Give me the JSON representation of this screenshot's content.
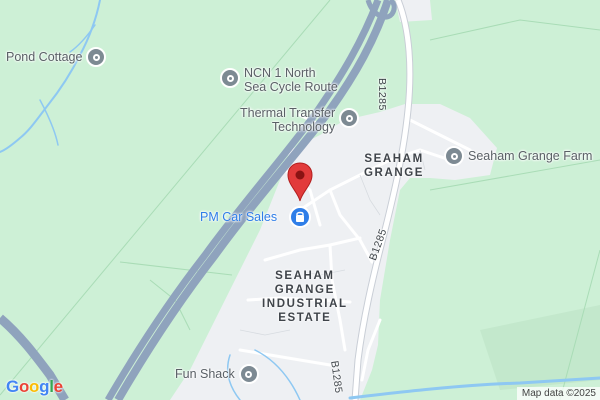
{
  "map": {
    "poi": {
      "pond_cottage": "Pond Cottage",
      "ncn_route": "NCN 1 North\nSea Cycle Route",
      "thermal_transfer": "Thermal Transfer\nTechnology",
      "seaham_grange_farm": "Seaham Grange Farm",
      "pm_car_sales": "PM Car Sales",
      "fun_shack": "Fun Shack"
    },
    "areas": {
      "seaham_grange": "SEAHAM\nGRANGE",
      "industrial_estate": "SEAHAM\nGRANGE\nINDUSTRIAL\nESTATE"
    },
    "roads": {
      "b1285_top": "B1285",
      "b1285_middle": "B1285",
      "b1285_bottom": "B1285"
    },
    "logo": {
      "g1": "G",
      "o1": "o",
      "o2": "o",
      "g2": "g",
      "l": "l",
      "e": "e",
      "colors": [
        "#4285F4",
        "#EA4335",
        "#FBBC05",
        "#4285F4",
        "#34A853",
        "#EA4335"
      ]
    },
    "attribution": "Map data ©2025",
    "colors": {
      "land": "#cdf0d6",
      "built_up": "#eef0f3",
      "road_major": "#8fa3bd",
      "water": "#8ec8f2",
      "marker": "#e23b3b",
      "shop_icon": "#2f7ee8",
      "poi_icon": "#7d8a93"
    },
    "icons": {
      "marker": "map-pin-icon",
      "poi": "place-icon",
      "shop": "shopping-bag-icon"
    }
  }
}
